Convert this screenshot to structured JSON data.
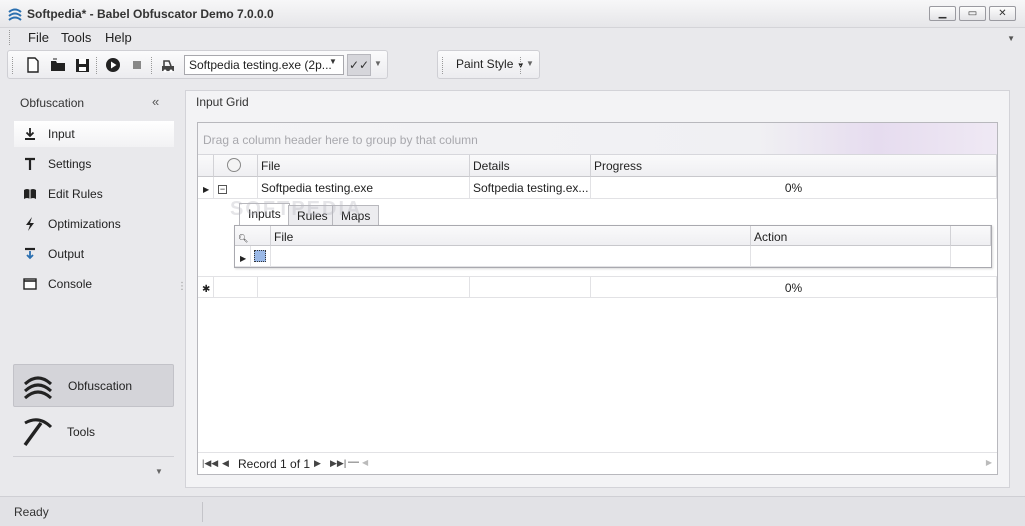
{
  "window": {
    "title": "Softpedia* - Babel Obfuscator Demo 7.0.0.0",
    "min_icon": "minimize-icon",
    "max_icon": "restore-icon",
    "close_icon": "close-icon"
  },
  "menu": {
    "items": [
      "File",
      "Tools",
      "Help"
    ]
  },
  "toolbar": {
    "target_value": "Softpedia testing.exe (2p...",
    "check_label": "✓✓",
    "paint_style_label": "Paint Style"
  },
  "nav": {
    "header": "Obfuscation",
    "items": [
      {
        "label": "Input",
        "icon": "download-icon",
        "selected": true
      },
      {
        "label": "Settings",
        "icon": "settings-icon",
        "selected": false
      },
      {
        "label": "Edit Rules",
        "icon": "book-icon",
        "selected": false
      },
      {
        "label": "Optimizations",
        "icon": "lightning-icon",
        "selected": false
      },
      {
        "label": "Output",
        "icon": "output-icon",
        "selected": false
      },
      {
        "label": "Console",
        "icon": "console-icon",
        "selected": false
      }
    ],
    "big_items": [
      {
        "label": "Obfuscation",
        "icon": "obfuscation-icon",
        "selected": true
      },
      {
        "label": "Tools",
        "icon": "pickaxe-icon",
        "selected": false
      }
    ]
  },
  "panel": {
    "title": "Input Grid",
    "group_hint": "Drag a column header here to group by that column",
    "columns": [
      "File",
      "Details",
      "Progress"
    ],
    "rows": [
      {
        "file": "Softpedia testing.exe",
        "details": "Softpedia testing.ex...",
        "progress": "0%"
      }
    ],
    "new_row": {
      "progress": "0%"
    },
    "detail_tabs": [
      "Inputs",
      "Rules",
      "Maps"
    ],
    "detail_columns": [
      "File",
      "Action"
    ],
    "record_text": "Record 1 of 1"
  },
  "status": {
    "text": "Ready"
  },
  "watermark": "SOFTPEDIA"
}
